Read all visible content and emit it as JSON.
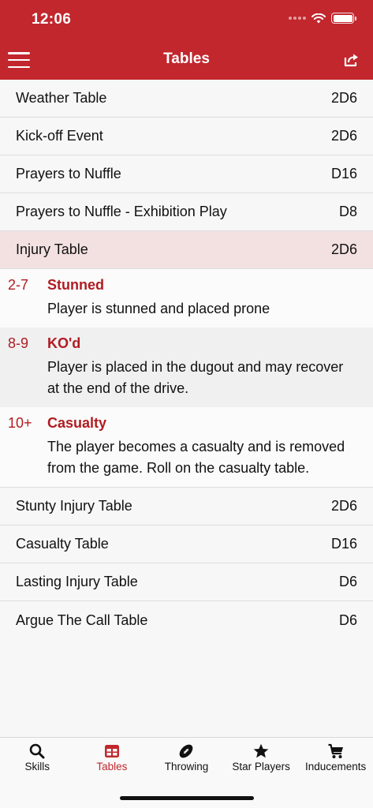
{
  "status": {
    "time": "12:06"
  },
  "nav": {
    "title": "Tables"
  },
  "tables_top": [
    {
      "name": "Weather Table",
      "dice": "2D6"
    },
    {
      "name": "Kick-off Event",
      "dice": "2D6"
    },
    {
      "name": "Prayers to Nuffle",
      "dice": "D16"
    },
    {
      "name": "Prayers to Nuffle - Exhibition Play",
      "dice": "D8"
    }
  ],
  "selected_table": {
    "name": "Injury Table",
    "dice": "2D6"
  },
  "injury_entries": [
    {
      "roll": "2-7",
      "name": "Stunned",
      "description": "Player is stunned and placed prone"
    },
    {
      "roll": "8-9",
      "name": "KO'd",
      "description": "Player is placed in the dugout and may recover at the end of the drive."
    },
    {
      "roll": "10+",
      "name": "Casualty",
      "description": "The player becomes a casualty and is removed from the game. Roll on the casualty table."
    }
  ],
  "tables_bottom": [
    {
      "name": "Stunty Injury Table",
      "dice": "2D6"
    },
    {
      "name": "Casualty Table",
      "dice": "D16"
    },
    {
      "name": "Lasting Injury Table",
      "dice": "D6"
    },
    {
      "name": "Argue The Call Table",
      "dice": "D6"
    }
  ],
  "tabbar": {
    "tabs": [
      {
        "label": "Skills",
        "icon": "search-icon"
      },
      {
        "label": "Tables",
        "icon": "table-icon",
        "active": true
      },
      {
        "label": "Throwing",
        "icon": "football-icon"
      },
      {
        "label": "Star Players",
        "icon": "star-icon"
      },
      {
        "label": "Inducements",
        "icon": "cart-icon"
      }
    ]
  },
  "colors": {
    "accent": "#c1272d",
    "selected_row": "#f3e1e1",
    "roll_text": "#b01c22"
  }
}
